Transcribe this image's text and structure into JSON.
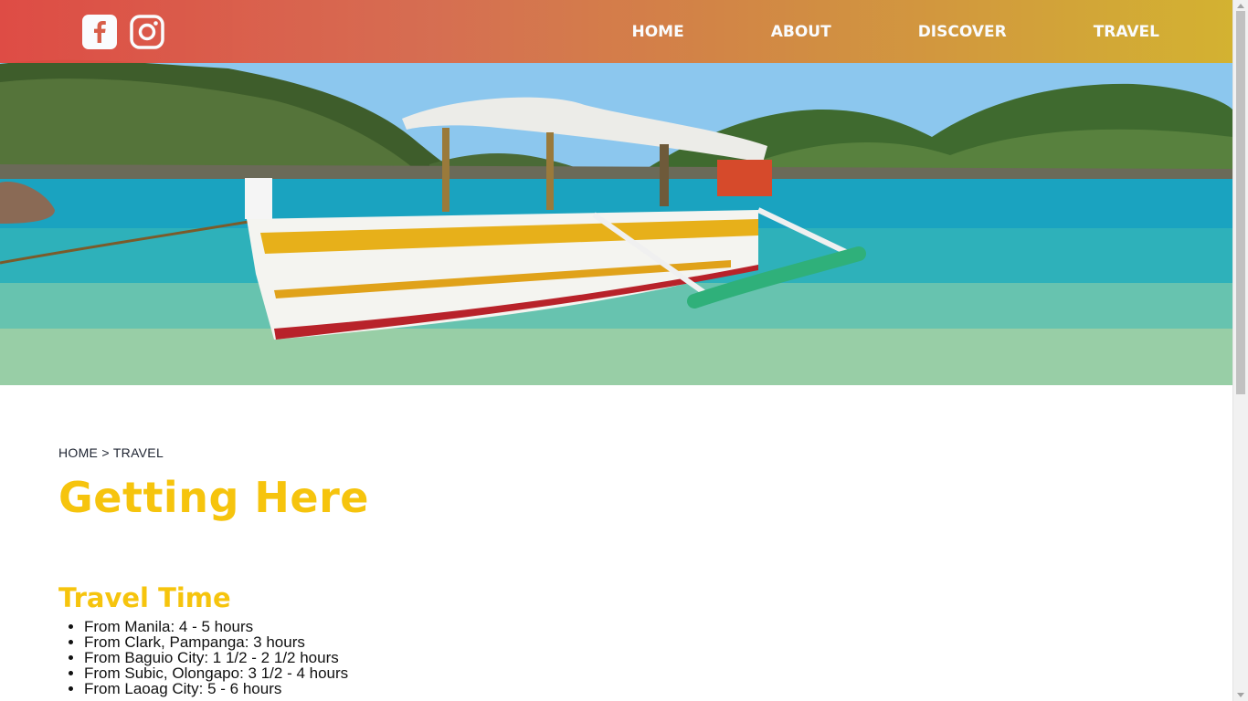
{
  "social": {
    "icons": [
      "facebook-icon",
      "instagram-icon"
    ]
  },
  "nav": {
    "items": [
      "HOME",
      "ABOUT",
      "DISCOVER",
      "TRAVEL"
    ]
  },
  "breadcrumb": {
    "home": "HOME",
    "separator": " > ",
    "current": "TRAVEL"
  },
  "page": {
    "title": "Getting Here"
  },
  "travel_time": {
    "title": "Travel Time",
    "items": [
      "From Manila: 4 - 5 hours",
      "From Clark, Pampanga: 3 hours",
      "From Baguio City: 1 1/2 - 2 1/2 hours",
      "From Subic, Olongapo: 3 1/2 - 4 hours",
      "From Laoag City: 5 - 6 hours"
    ]
  },
  "colors": {
    "header_start": "#e2483f",
    "header_end": "#d6b22a",
    "title": "#f6c40d",
    "text": "#1d2330"
  }
}
